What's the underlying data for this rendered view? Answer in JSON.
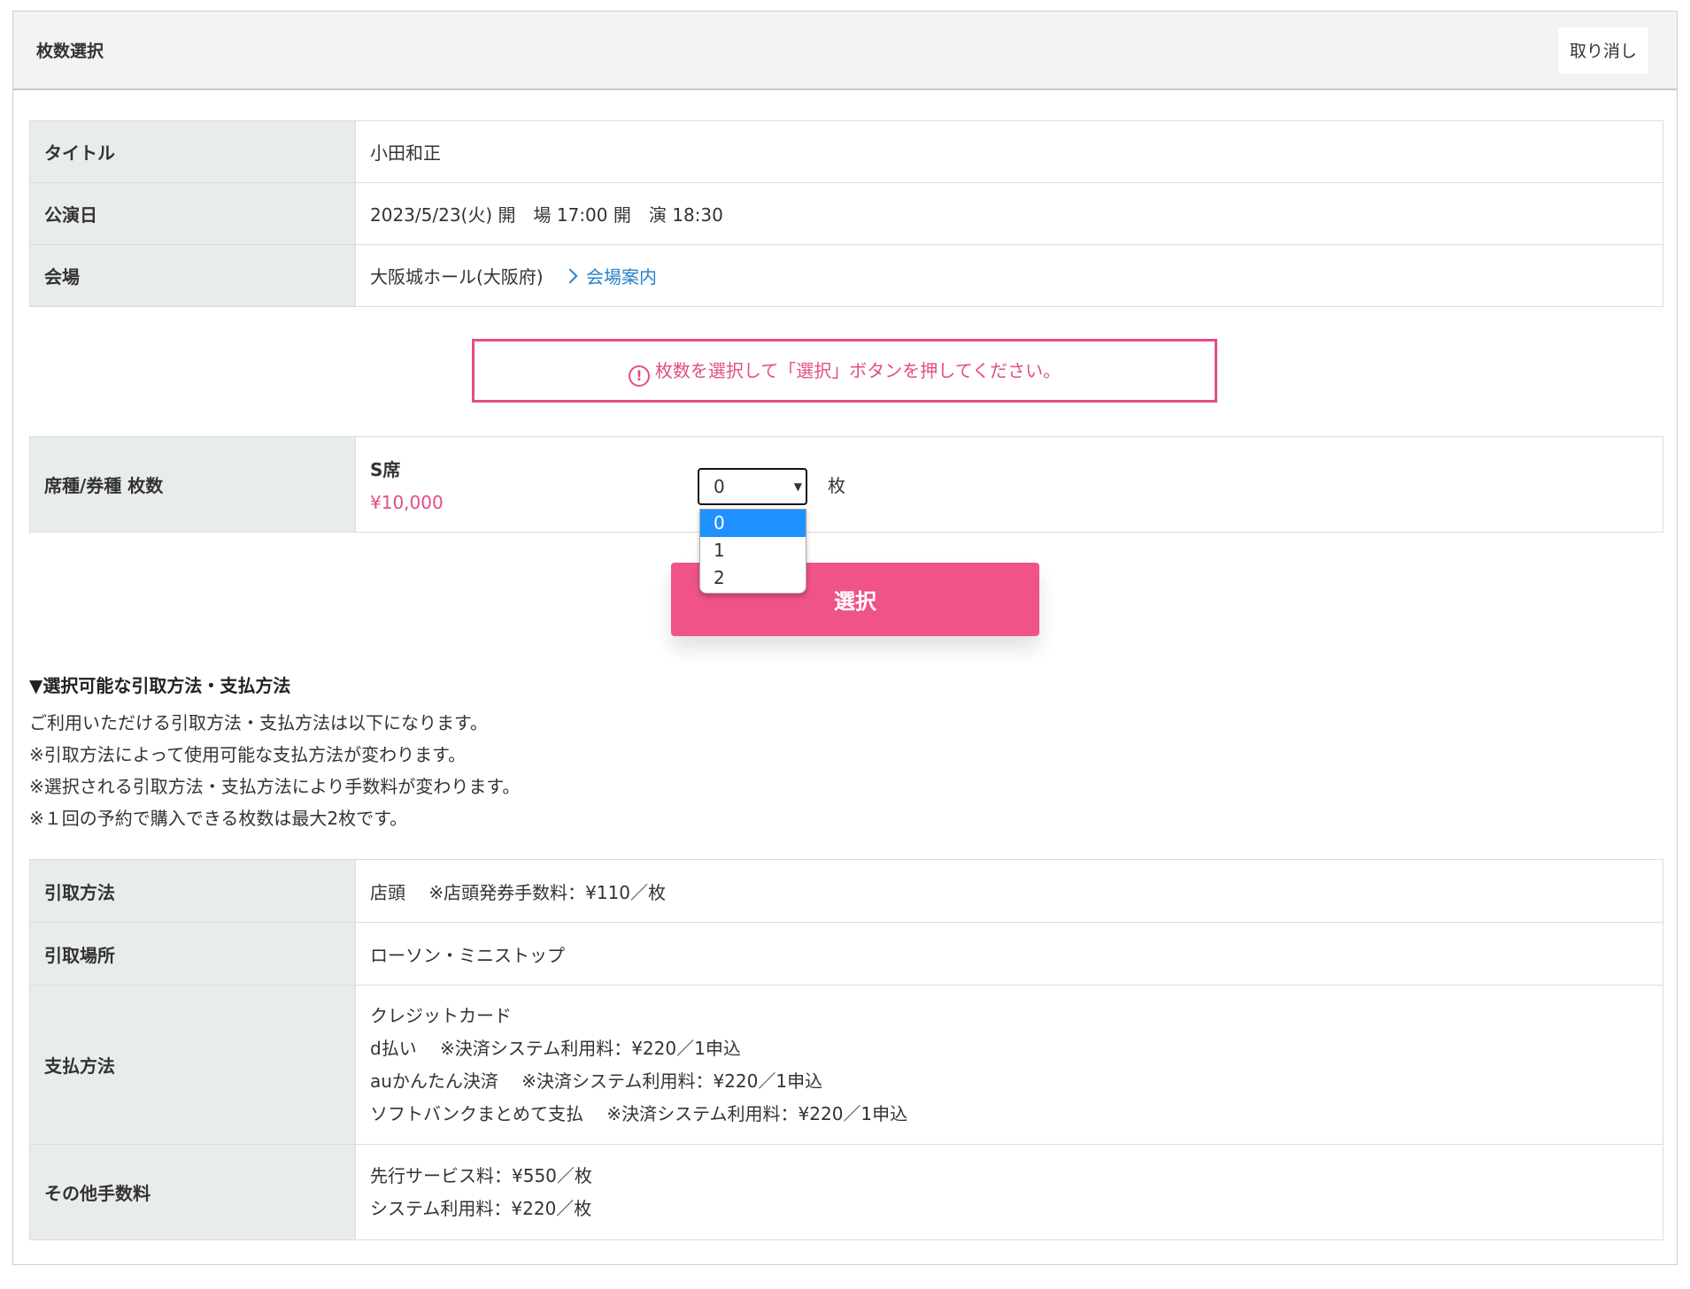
{
  "header": {
    "title": "枚数選択",
    "cancel_label": "取り消し"
  },
  "event": {
    "title_label": "タイトル",
    "title_value": "小田和正",
    "date_label": "公演日",
    "date_value": "2023/5/23(火) 開　場 17:00 開　演 18:30",
    "venue_label": "会場",
    "venue_value": "大阪城ホール(大阪府)",
    "venue_link": "会場案内"
  },
  "notice": {
    "icon": "alert-circle-icon",
    "text": "枚数を選択して「選択」ボタンを押してください。"
  },
  "ticket": {
    "label": "席種/券種 枚数",
    "seat_name": "S席",
    "price": "¥10,000",
    "selected": "0",
    "options": [
      "0",
      "1",
      "2"
    ],
    "unit": "枚"
  },
  "select_button": "選択",
  "methods": {
    "heading": "▼選択可能な引取方法・支払方法",
    "notes": [
      "ご利用いただける引取方法・支払方法は以下になります。",
      "※引取方法によって使用可能な支払方法が変わります。",
      "※選択される引取方法・支払方法により手数料が変わります。",
      "※１回の予約で購入できる枚数は最大2枚です。"
    ],
    "pickup_method_label": "引取方法",
    "pickup_method_value": "店頭　 ※店頭発券手数料：¥110／枚",
    "pickup_place_label": "引取場所",
    "pickup_place_value": "ローソン・ミニストップ",
    "payment_label": "支払方法",
    "payment_values": [
      "クレジットカード",
      "d払い　 ※決済システム利用料：¥220／1申込",
      "auかんたん決済　 ※決済システム利用料：¥220／1申込",
      "ソフトバンクまとめて支払　 ※決済システム利用料：¥220／1申込"
    ],
    "other_fees_label": "その他手数料",
    "other_fees_values": [
      "先行サービス料：¥550／枚",
      "システム利用料：¥220／枚"
    ]
  },
  "colors": {
    "accent": "#f0528a",
    "notice": "#e34c88",
    "link": "#2a82c8",
    "dropdown_highlight": "#1e90ff"
  }
}
